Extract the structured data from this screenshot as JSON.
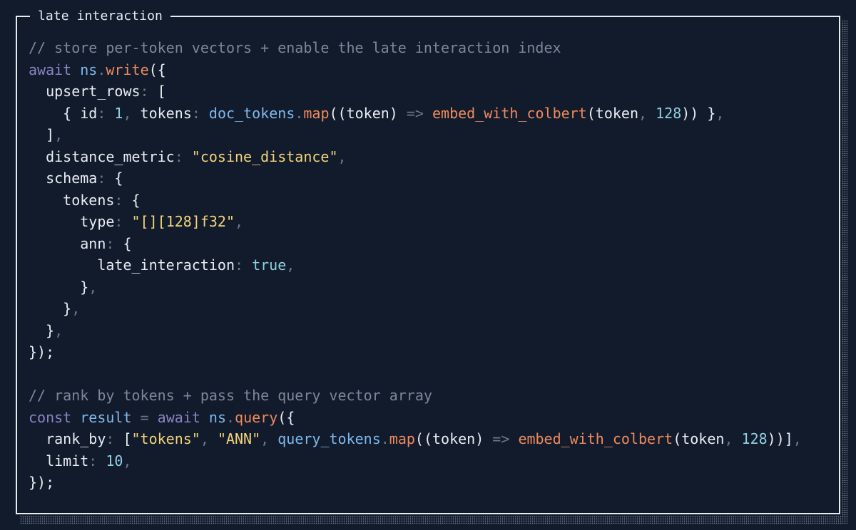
{
  "panel": {
    "title": "late interaction"
  },
  "colors": {
    "background": "#111b2c",
    "border": "#e8ecf2",
    "plain": "#e9edf3",
    "comment": "#7d8799",
    "keyword": "#8b84c2",
    "function": "#f08a5d",
    "property": "#7fb8ee",
    "string": "#f3d479",
    "number": "#8fd0e0",
    "punctuation": "#6e7687"
  },
  "code": {
    "lines": [
      [
        [
          "comment",
          "// store per-token vectors + enable the late interaction index"
        ]
      ],
      [
        [
          "kw",
          "await"
        ],
        [
          "plain",
          " "
        ],
        [
          "prop",
          "ns"
        ],
        [
          "punc",
          "."
        ],
        [
          "fn",
          "write"
        ],
        [
          "plain",
          "({"
        ]
      ],
      [
        [
          "plain",
          "  upsert_rows"
        ],
        [
          "punc",
          ":"
        ],
        [
          "plain",
          " ["
        ]
      ],
      [
        [
          "plain",
          "    { id"
        ],
        [
          "punc",
          ":"
        ],
        [
          "plain",
          " "
        ],
        [
          "num",
          "1"
        ],
        [
          "punc",
          ","
        ],
        [
          "plain",
          " tokens"
        ],
        [
          "punc",
          ":"
        ],
        [
          "plain",
          " "
        ],
        [
          "prop",
          "doc_tokens"
        ],
        [
          "punc",
          "."
        ],
        [
          "fn",
          "map"
        ],
        [
          "plain",
          "((token) "
        ],
        [
          "punc",
          "=>"
        ],
        [
          "plain",
          " "
        ],
        [
          "fn",
          "embed_with_colbert"
        ],
        [
          "plain",
          "(token"
        ],
        [
          "punc",
          ","
        ],
        [
          "plain",
          " "
        ],
        [
          "num",
          "128"
        ],
        [
          "plain",
          ")) }"
        ],
        [
          "punc",
          ","
        ]
      ],
      [
        [
          "plain",
          "  ]"
        ],
        [
          "punc",
          ","
        ]
      ],
      [
        [
          "plain",
          "  distance_metric"
        ],
        [
          "punc",
          ":"
        ],
        [
          "plain",
          " "
        ],
        [
          "str",
          "\"cosine_distance\""
        ],
        [
          "punc",
          ","
        ]
      ],
      [
        [
          "plain",
          "  schema"
        ],
        [
          "punc",
          ":"
        ],
        [
          "plain",
          " {"
        ]
      ],
      [
        [
          "plain",
          "    tokens"
        ],
        [
          "punc",
          ":"
        ],
        [
          "plain",
          " {"
        ]
      ],
      [
        [
          "plain",
          "      type"
        ],
        [
          "punc",
          ":"
        ],
        [
          "plain",
          " "
        ],
        [
          "str",
          "\"[][128]f32\""
        ],
        [
          "punc",
          ","
        ]
      ],
      [
        [
          "plain",
          "      ann"
        ],
        [
          "punc",
          ":"
        ],
        [
          "plain",
          " {"
        ]
      ],
      [
        [
          "plain",
          "        late_interaction"
        ],
        [
          "punc",
          ":"
        ],
        [
          "plain",
          " "
        ],
        [
          "num",
          "true"
        ],
        [
          "punc",
          ","
        ]
      ],
      [
        [
          "plain",
          "      }"
        ],
        [
          "punc",
          ","
        ]
      ],
      [
        [
          "plain",
          "    }"
        ],
        [
          "punc",
          ","
        ]
      ],
      [
        [
          "plain",
          "  }"
        ],
        [
          "punc",
          ","
        ]
      ],
      [
        [
          "plain",
          "});"
        ]
      ],
      [
        [
          "plain",
          ""
        ]
      ],
      [
        [
          "comment",
          "// rank by tokens + pass the query vector array"
        ]
      ],
      [
        [
          "kw",
          "const"
        ],
        [
          "plain",
          " "
        ],
        [
          "prop",
          "result"
        ],
        [
          "plain",
          " "
        ],
        [
          "punc",
          "="
        ],
        [
          "plain",
          " "
        ],
        [
          "kw",
          "await"
        ],
        [
          "plain",
          " "
        ],
        [
          "prop",
          "ns"
        ],
        [
          "punc",
          "."
        ],
        [
          "fn",
          "query"
        ],
        [
          "plain",
          "({"
        ]
      ],
      [
        [
          "plain",
          "  rank_by"
        ],
        [
          "punc",
          ":"
        ],
        [
          "plain",
          " ["
        ],
        [
          "str",
          "\"tokens\""
        ],
        [
          "punc",
          ","
        ],
        [
          "plain",
          " "
        ],
        [
          "str",
          "\"ANN\""
        ],
        [
          "punc",
          ","
        ],
        [
          "plain",
          " "
        ],
        [
          "prop",
          "query_tokens"
        ],
        [
          "punc",
          "."
        ],
        [
          "fn",
          "map"
        ],
        [
          "plain",
          "((token) "
        ],
        [
          "punc",
          "=>"
        ],
        [
          "plain",
          " "
        ],
        [
          "fn",
          "embed_with_colbert"
        ],
        [
          "plain",
          "(token"
        ],
        [
          "punc",
          ","
        ],
        [
          "plain",
          " "
        ],
        [
          "num",
          "128"
        ],
        [
          "plain",
          "))]"
        ],
        [
          "punc",
          ","
        ]
      ],
      [
        [
          "plain",
          "  limit"
        ],
        [
          "punc",
          ":"
        ],
        [
          "plain",
          " "
        ],
        [
          "num",
          "10"
        ],
        [
          "punc",
          ","
        ]
      ],
      [
        [
          "plain",
          "});"
        ]
      ]
    ]
  }
}
